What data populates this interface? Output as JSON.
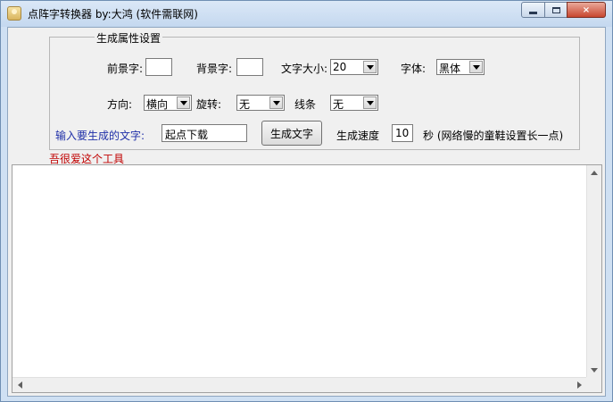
{
  "window": {
    "title": "点阵字转换器  by:大鸿 (软件需联网)",
    "icon": "app-icon",
    "controls": {
      "minimize": "minimize-icon",
      "maximize": "maximize-icon",
      "close": "×"
    }
  },
  "settings": {
    "group_title": "生成属性设置",
    "foreground_label": "前景字:",
    "foreground_value": "",
    "background_label": "背景字:",
    "background_value": "",
    "font_size_label": "文字大小:",
    "font_size_value": "20",
    "font_label": "字体:",
    "font_value": "黑体",
    "direction_label": "方向:",
    "direction_value": "横向",
    "rotate_label": "旋转:",
    "rotate_value": "无",
    "line_label": "线条",
    "line_value": "无"
  },
  "input_row": {
    "prompt_label": "输入要生成的文字:",
    "text_value": "起点下载",
    "generate_button": "生成文字",
    "speed_label": "生成速度",
    "speed_value": "10",
    "speed_hint": "秒 (网络慢的童鞋设置长一点)"
  },
  "red_note": "吾很爱这个工具",
  "output": {
    "content": ""
  },
  "colors": {
    "prompt": "#1f2fa8",
    "note": "#c00000",
    "close_button": "#c8462f"
  }
}
